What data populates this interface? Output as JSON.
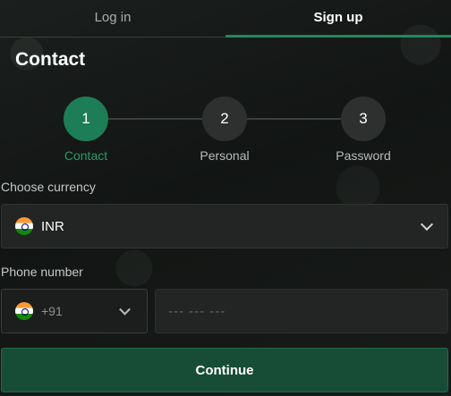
{
  "tabs": [
    {
      "label": "Log in",
      "active": false
    },
    {
      "label": "Sign up",
      "active": true
    }
  ],
  "page_title": "Contact",
  "stepper": {
    "steps": [
      {
        "number": "1",
        "label": "Contact",
        "active": true
      },
      {
        "number": "2",
        "label": "Personal",
        "active": false
      },
      {
        "number": "3",
        "label": "Password",
        "active": false
      }
    ]
  },
  "currency": {
    "label": "Choose currency",
    "flag_icon": "india-flag-icon",
    "value": "INR"
  },
  "phone": {
    "label": "Phone number",
    "flag_icon": "india-flag-icon",
    "code": "+91",
    "placeholder": "--- --- ---",
    "value": ""
  },
  "continue_label": "Continue",
  "colors": {
    "accent": "#1d7d56",
    "accent_text": "#2a9a6b",
    "button": "#174d36",
    "background": "#111412"
  }
}
